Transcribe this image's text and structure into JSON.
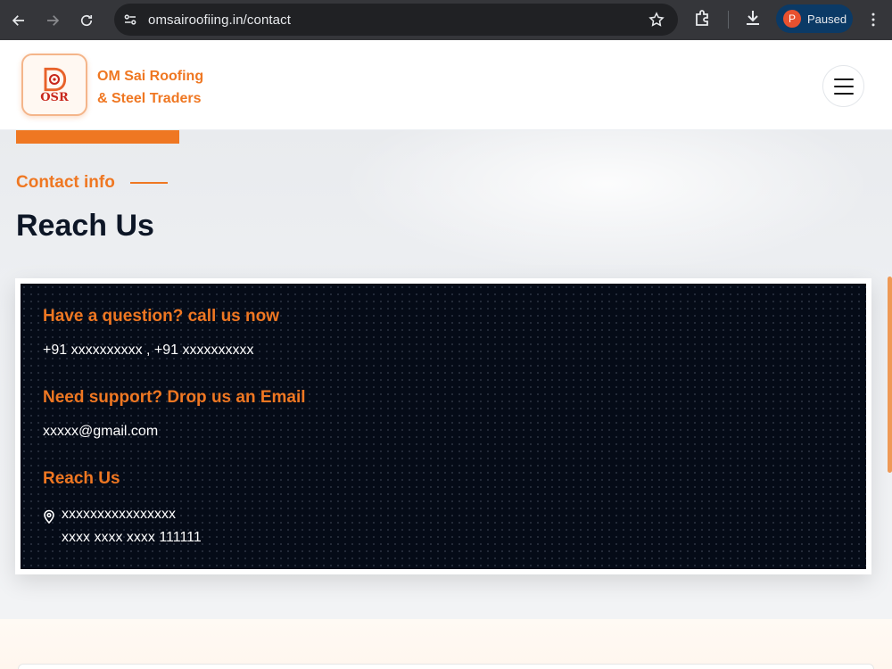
{
  "browser": {
    "url": "omsairoofiing.in/contact",
    "profile_initial": "P",
    "profile_status": "Paused",
    "colors": {
      "chrome_bg": "#35363a",
      "omnibox_bg": "#202124",
      "profile_pill": "#0b3a66",
      "avatar": "#e8512f"
    }
  },
  "header": {
    "logo_text": "OSR",
    "brand_line1": "OM Sai Roofing",
    "brand_line2": "& Steel Traders"
  },
  "hero": {
    "eyebrow": "Contact info",
    "title": "Reach Us"
  },
  "contact": {
    "phone_heading": "Have a question? call us now",
    "phone_value": "+91 xxxxxxxxxx , +91 xxxxxxxxxx",
    "email_heading": "Need support? Drop us an Email",
    "email_value": "xxxxx@gmail.com",
    "address_heading": "Reach Us",
    "address_line1": "xxxxxxxxxxxxxxxx",
    "address_line2": "xxxx xxxx xxxx 111111"
  },
  "theme": {
    "accent": "#ef7722",
    "dark_panel": "#050b17",
    "title_color": "#0d1626"
  }
}
